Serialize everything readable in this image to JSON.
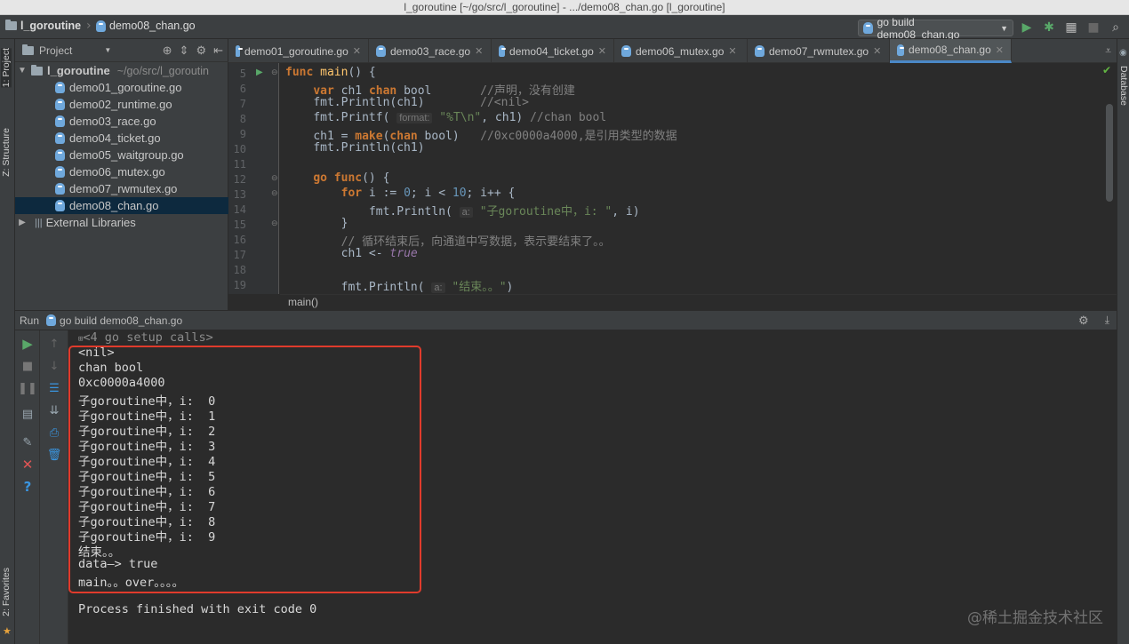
{
  "window_title": "l_goroutine [~/go/src/l_goroutine] - .../demo08_chan.go [l_goroutine]",
  "navbar": {
    "project": "l_goroutine",
    "file": "demo08_chan.go",
    "run_config": "go build demo08_chan.go"
  },
  "left_strip": {
    "project_tab": "1: Project",
    "structure_tab": "Z: Structure",
    "favorites_tab": "2: Favorites"
  },
  "right_strip": {
    "database_tab": "Database"
  },
  "project_panel": {
    "header_label": "Project",
    "root": "l_goroutine",
    "root_path": "~/go/src/l_goroutin",
    "files": [
      "demo01_goroutine.go",
      "demo02_runtime.go",
      "demo03_race.go",
      "demo04_ticket.go",
      "demo05_waitgroup.go",
      "demo06_mutex.go",
      "demo07_rwmutex.go",
      "demo08_chan.go"
    ],
    "external": "External Libraries"
  },
  "editor_tabs": [
    "demo01_goroutine.go",
    "demo03_race.go",
    "demo04_ticket.go",
    "demo06_mutex.go",
    "demo07_rwmutex.go",
    "demo08_chan.go"
  ],
  "editor": {
    "line_numbers": [
      "5",
      "6",
      "7",
      "8",
      "9",
      "10",
      "11",
      "12",
      "13",
      "14",
      "15",
      "16",
      "17",
      "18",
      "19"
    ],
    "lines": {
      "l5_kw": "func",
      "l5_fn": "main",
      "l5_rest": "() {",
      "l6_kw": "var",
      "l6_mid": " ch1 ",
      "l6_kw2": "chan",
      "l6_type": " bool       ",
      "l6_cm": "//声明，没有创建",
      "l7_code": "fmt.Println(ch1)        ",
      "l7_cm": "//<nil>",
      "l8_a": "fmt.Printf( ",
      "l8_hint": "format:",
      "l8_st": "\"%T\\n\"",
      "l8_b": ", ch1) ",
      "l8_cm": "//chan bool",
      "l9_a": "ch1 = ",
      "l9_kw": "make",
      "l9_b": "(",
      "l9_kw2": "chan",
      "l9_c": " bool)   ",
      "l9_cm": "//0xc0000a4000,是引用类型的数据",
      "l10_code": "fmt.Println(ch1)",
      "l12_kw": "go",
      "l12_kw2": "func",
      "l12_rest": "() {",
      "l13_kw": "for",
      "l13_a": " i := ",
      "l13_n1": "0",
      "l13_b": "; i < ",
      "l13_n2": "10",
      "l13_c": "; i++ {",
      "l14_a": "fmt.Println( ",
      "l14_hint": "a:",
      "l14_st": "\"子goroutine中，i: \"",
      "l14_b": ", i)",
      "l15_code": "}",
      "l16_cm": "// 循环结束后，向通道中写数据，表示要结束了。。",
      "l17_a": "ch1 <- ",
      "l17_it": "true",
      "l19_a": "fmt.Println( ",
      "l19_hint": "a:",
      "l19_st": "\"结束。。\"",
      "l19_b": ")"
    },
    "breadcrumb": "main()"
  },
  "run": {
    "label": "Run",
    "config": "go build demo08_chan.go",
    "setup_calls": "<4 go setup calls>",
    "output": [
      "<nil>",
      "chan bool",
      "0xc0000a4000",
      "子goroutine中，i:  0",
      "子goroutine中，i:  1",
      "子goroutine中，i:  2",
      "子goroutine中，i:  3",
      "子goroutine中，i:  4",
      "子goroutine中，i:  5",
      "子goroutine中，i:  6",
      "子goroutine中，i:  7",
      "子goroutine中，i:  8",
      "子goroutine中，i:  9",
      "结束。。",
      "data—> true",
      "main。。over。。。。"
    ],
    "exit_message": "Process finished with exit code 0"
  },
  "watermark": "@稀土掘金技术社区",
  "colors": {
    "background": "#2b2b2b",
    "panel": "#3c3f41",
    "selection": "#0d293e",
    "highlight_box": "#e03b2c",
    "run_green": "#59a869"
  }
}
